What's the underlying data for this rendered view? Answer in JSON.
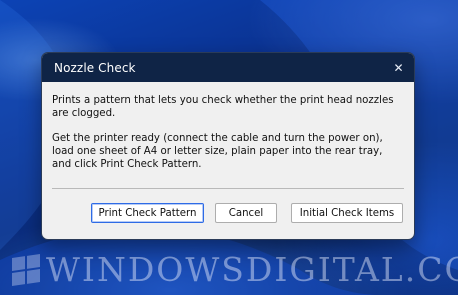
{
  "window": {
    "title": "Nozzle Check",
    "close_symbol": "✕"
  },
  "content": {
    "paragraph_1": "Prints a pattern that lets you check whether the print head nozzles are clogged.",
    "paragraph_2": "Get the printer ready (connect the cable and turn the power on), load one sheet of A4 or letter size, plain paper into the rear tray, and click Print Check Pattern."
  },
  "buttons": {
    "print_check_pattern": "Print Check Pattern",
    "cancel": "Cancel",
    "initial_check_items": "Initial Check Items"
  },
  "watermark": {
    "text": "WindowsDigital.com"
  },
  "icons": {
    "close": "close-icon",
    "windows_logo": "windows-logo-icon"
  },
  "colors": {
    "titlebar": "#0f2446",
    "dialog_bg": "#f0f0f0",
    "primary_border": "#2e6be6",
    "wallpaper": "#0b2d77"
  }
}
